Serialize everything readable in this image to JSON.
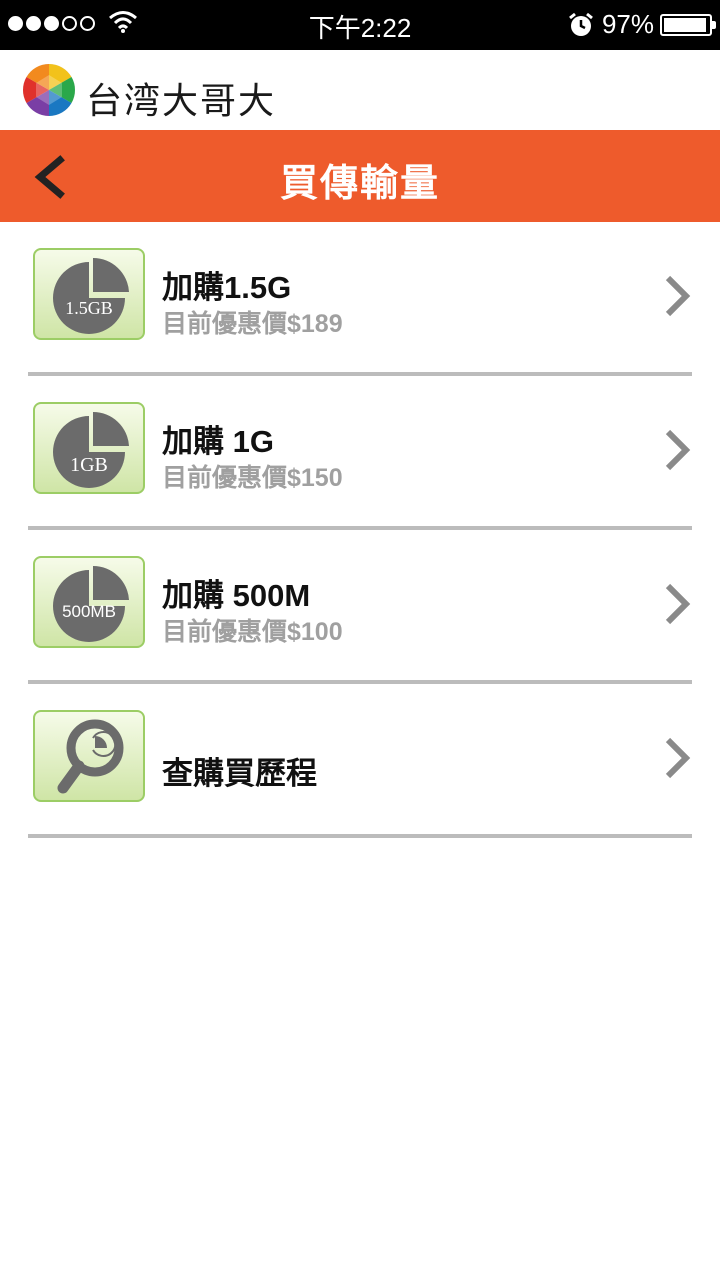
{
  "status_bar": {
    "time": "下午2:22",
    "battery": "97%",
    "signal_dots_filled": 3,
    "signal_dots_total": 5,
    "battery_level": 0.97
  },
  "brand": {
    "name": "台湾大哥大"
  },
  "header": {
    "title": "買傳輸量",
    "back_icon": "chevron-left-icon"
  },
  "colors": {
    "header_bg": "#ee5b2c",
    "icon_border": "#9ccd65",
    "subtitle": "#a0a0a0"
  },
  "items": [
    {
      "title": "加購1.5G",
      "subtitle": "目前優惠價$189",
      "icon_label": "1.5GB",
      "icon": "pie-chart-icon"
    },
    {
      "title": "加購 1G",
      "subtitle": "目前優惠價$150",
      "icon_label": "1GB",
      "icon": "pie-chart-icon"
    },
    {
      "title": "加購 500M",
      "subtitle": "目前優惠價$100",
      "icon_label": "500MB",
      "icon": "pie-chart-icon"
    },
    {
      "title": "查購買歷程",
      "subtitle": "",
      "icon": "magnifier-history-icon"
    }
  ]
}
